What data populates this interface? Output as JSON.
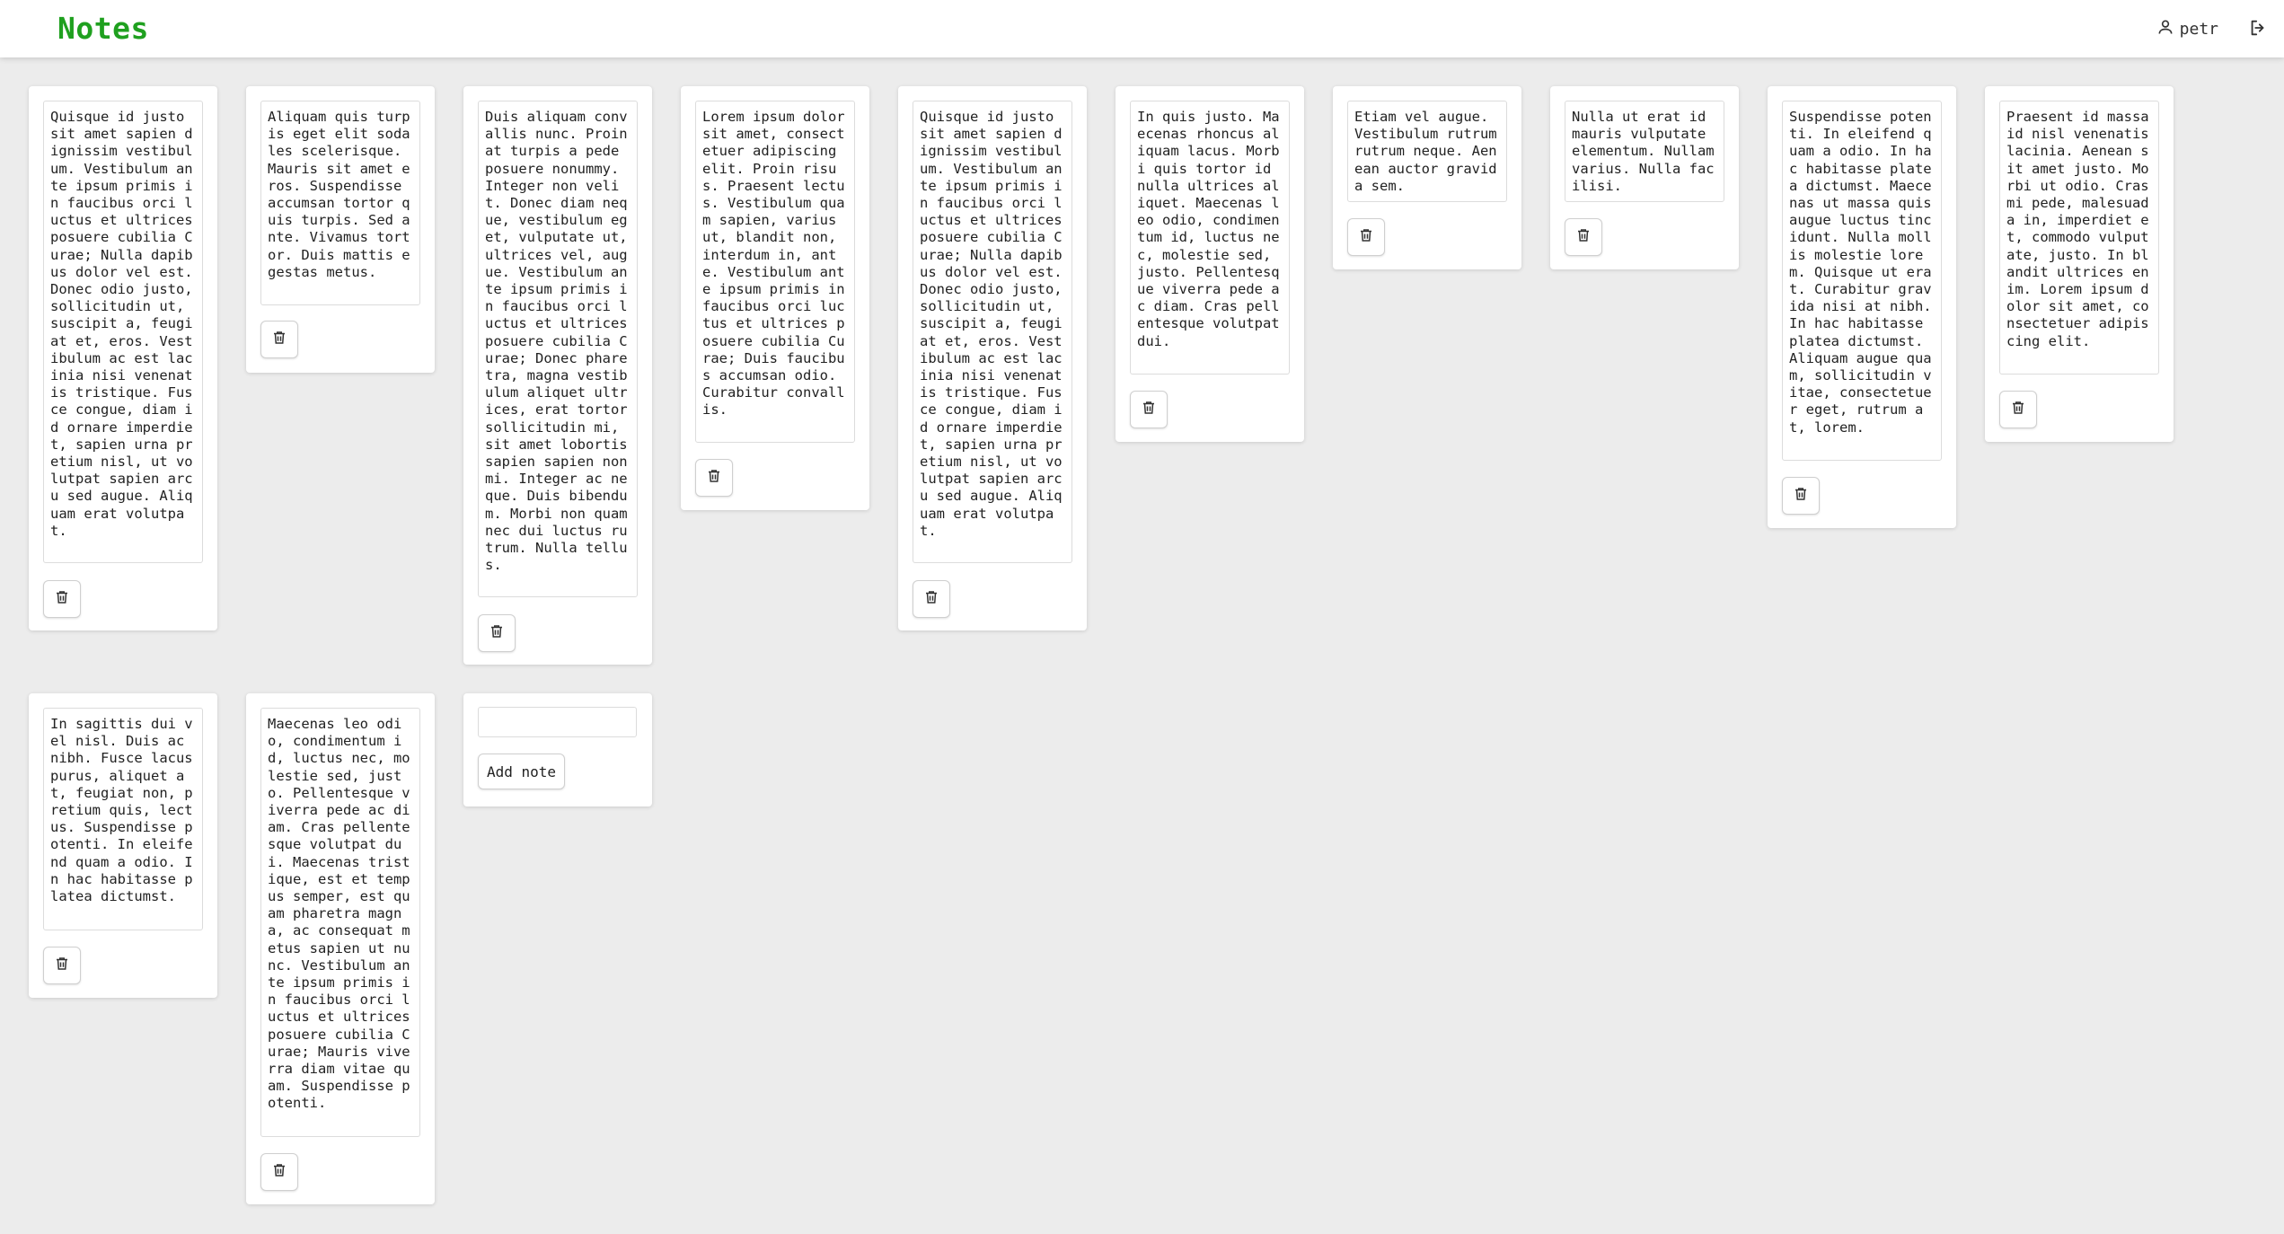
{
  "app": {
    "title": "Notes",
    "brand_color": "#1fa01f",
    "user_name": "petr",
    "user_icon": "person-icon",
    "logout_icon": "logout-icon"
  },
  "notes": [
    {
      "text": "Quisque id justo sit amet sapien dignissim vestibulum. Vestibulum ante ipsum primis in faucibus orci luctus et ultrices posuere cubilia Curae; Nulla dapibus dolor vel est. Donec odio justo, sollicitudin ut, suscipit a, feugiat et, eros. Vestibulum ac est lacinia nisi venenatis tristique. Fusce congue, diam id ornare imperdiet, sapien urna pretium nisl, ut volutpat sapien arcu sed augue. Aliquam erat volutpat."
    },
    {
      "text": "Aliquam quis turpis eget elit sodales scelerisque. Mauris sit amet eros. Suspendisse accumsan tortor quis turpis. Sed ante. Vivamus tortor. Duis mattis egestas metus."
    },
    {
      "text": "Duis aliquam convallis nunc. Proin at turpis a pede posuere nonummy. Integer non velit. Donec diam neque, vestibulum eget, vulputate ut, ultrices vel, augue. Vestibulum ante ipsum primis in faucibus orci luctus et ultrices posuere cubilia Curae; Donec pharetra, magna vestibulum aliquet ultrices, erat tortor sollicitudin mi, sit amet lobortis sapien sapien non mi. Integer ac neque. Duis bibendum. Morbi non quam nec dui luctus rutrum. Nulla tellus."
    },
    {
      "text": "Lorem ipsum dolor sit amet, consectetuer adipiscing elit. Proin risus. Praesent lectus. Vestibulum quam sapien, varius ut, blandit non, interdum in, ante. Vestibulum ante ipsum primis in faucibus orci luctus et ultrices posuere cubilia Curae; Duis faucibus accumsan odio. Curabitur convallis."
    },
    {
      "text": "Quisque id justo sit amet sapien dignissim vestibulum. Vestibulum ante ipsum primis in faucibus orci luctus et ultrices posuere cubilia Curae; Nulla dapibus dolor vel est. Donec odio justo, sollicitudin ut, suscipit a, feugiat et, eros. Vestibulum ac est lacinia nisi venenatis tristique. Fusce congue, diam id ornare imperdiet, sapien urna pretium nisl, ut volutpat sapien arcu sed augue. Aliquam erat volutpat."
    },
    {
      "text": "In quis justo. Maecenas rhoncus aliquam lacus. Morbi quis tortor id nulla ultrices aliquet. Maecenas leo odio, condimentum id, luctus nec, molestie sed, justo. Pellentesque viverra pede ac diam. Cras pellentesque volutpat dui."
    },
    {
      "text": "Etiam vel augue. Vestibulum rutrum rutrum neque. Aenean auctor gravida sem."
    },
    {
      "text": "Nulla ut erat id mauris vulputate elementum. Nullam varius. Nulla facilisi."
    },
    {
      "text": "Suspendisse potenti. In eleifend quam a odio. In hac habitasse platea dictumst. Maecenas ut massa quis augue luctus tincidunt. Nulla mollis molestie lorem. Quisque ut erat. Curabitur gravida nisi at nibh. In hac habitasse platea dictumst. Aliquam augue quam, sollicitudin vitae, consectetuer eget, rutrum at, lorem."
    },
    {
      "text": "Praesent id massa id nisl venenatis lacinia. Aenean sit amet justo. Morbi ut odio. Cras mi pede, malesuada in, imperdiet et, commodo vulputate, justo. In blandit ultrices enim. Lorem ipsum dolor sit amet, consectetuer adipiscing elit."
    },
    {
      "text": "In sagittis dui vel nisl. Duis ac nibh. Fusce lacus purus, aliquet at, feugiat non, pretium quis, lectus. Suspendisse potenti. In eleifend quam a odio. In hac habitasse platea dictumst."
    },
    {
      "text": "Maecenas leo odio, condimentum id, luctus nec, molestie sed, justo. Pellentesque viverra pede ac diam. Cras pellentesque volutpat dui. Maecenas tristique, est et tempus semper, est quam pharetra magna, ac consequat metus sapien ut nunc. Vestibulum ante ipsum primis in faucibus orci luctus et ultrices posuere cubilia Curae; Mauris viverra diam vitae quam. Suspendisse potenti."
    }
  ],
  "delete_icon": "trash-icon",
  "new_note": {
    "input_value": "",
    "add_label": "Add note"
  }
}
